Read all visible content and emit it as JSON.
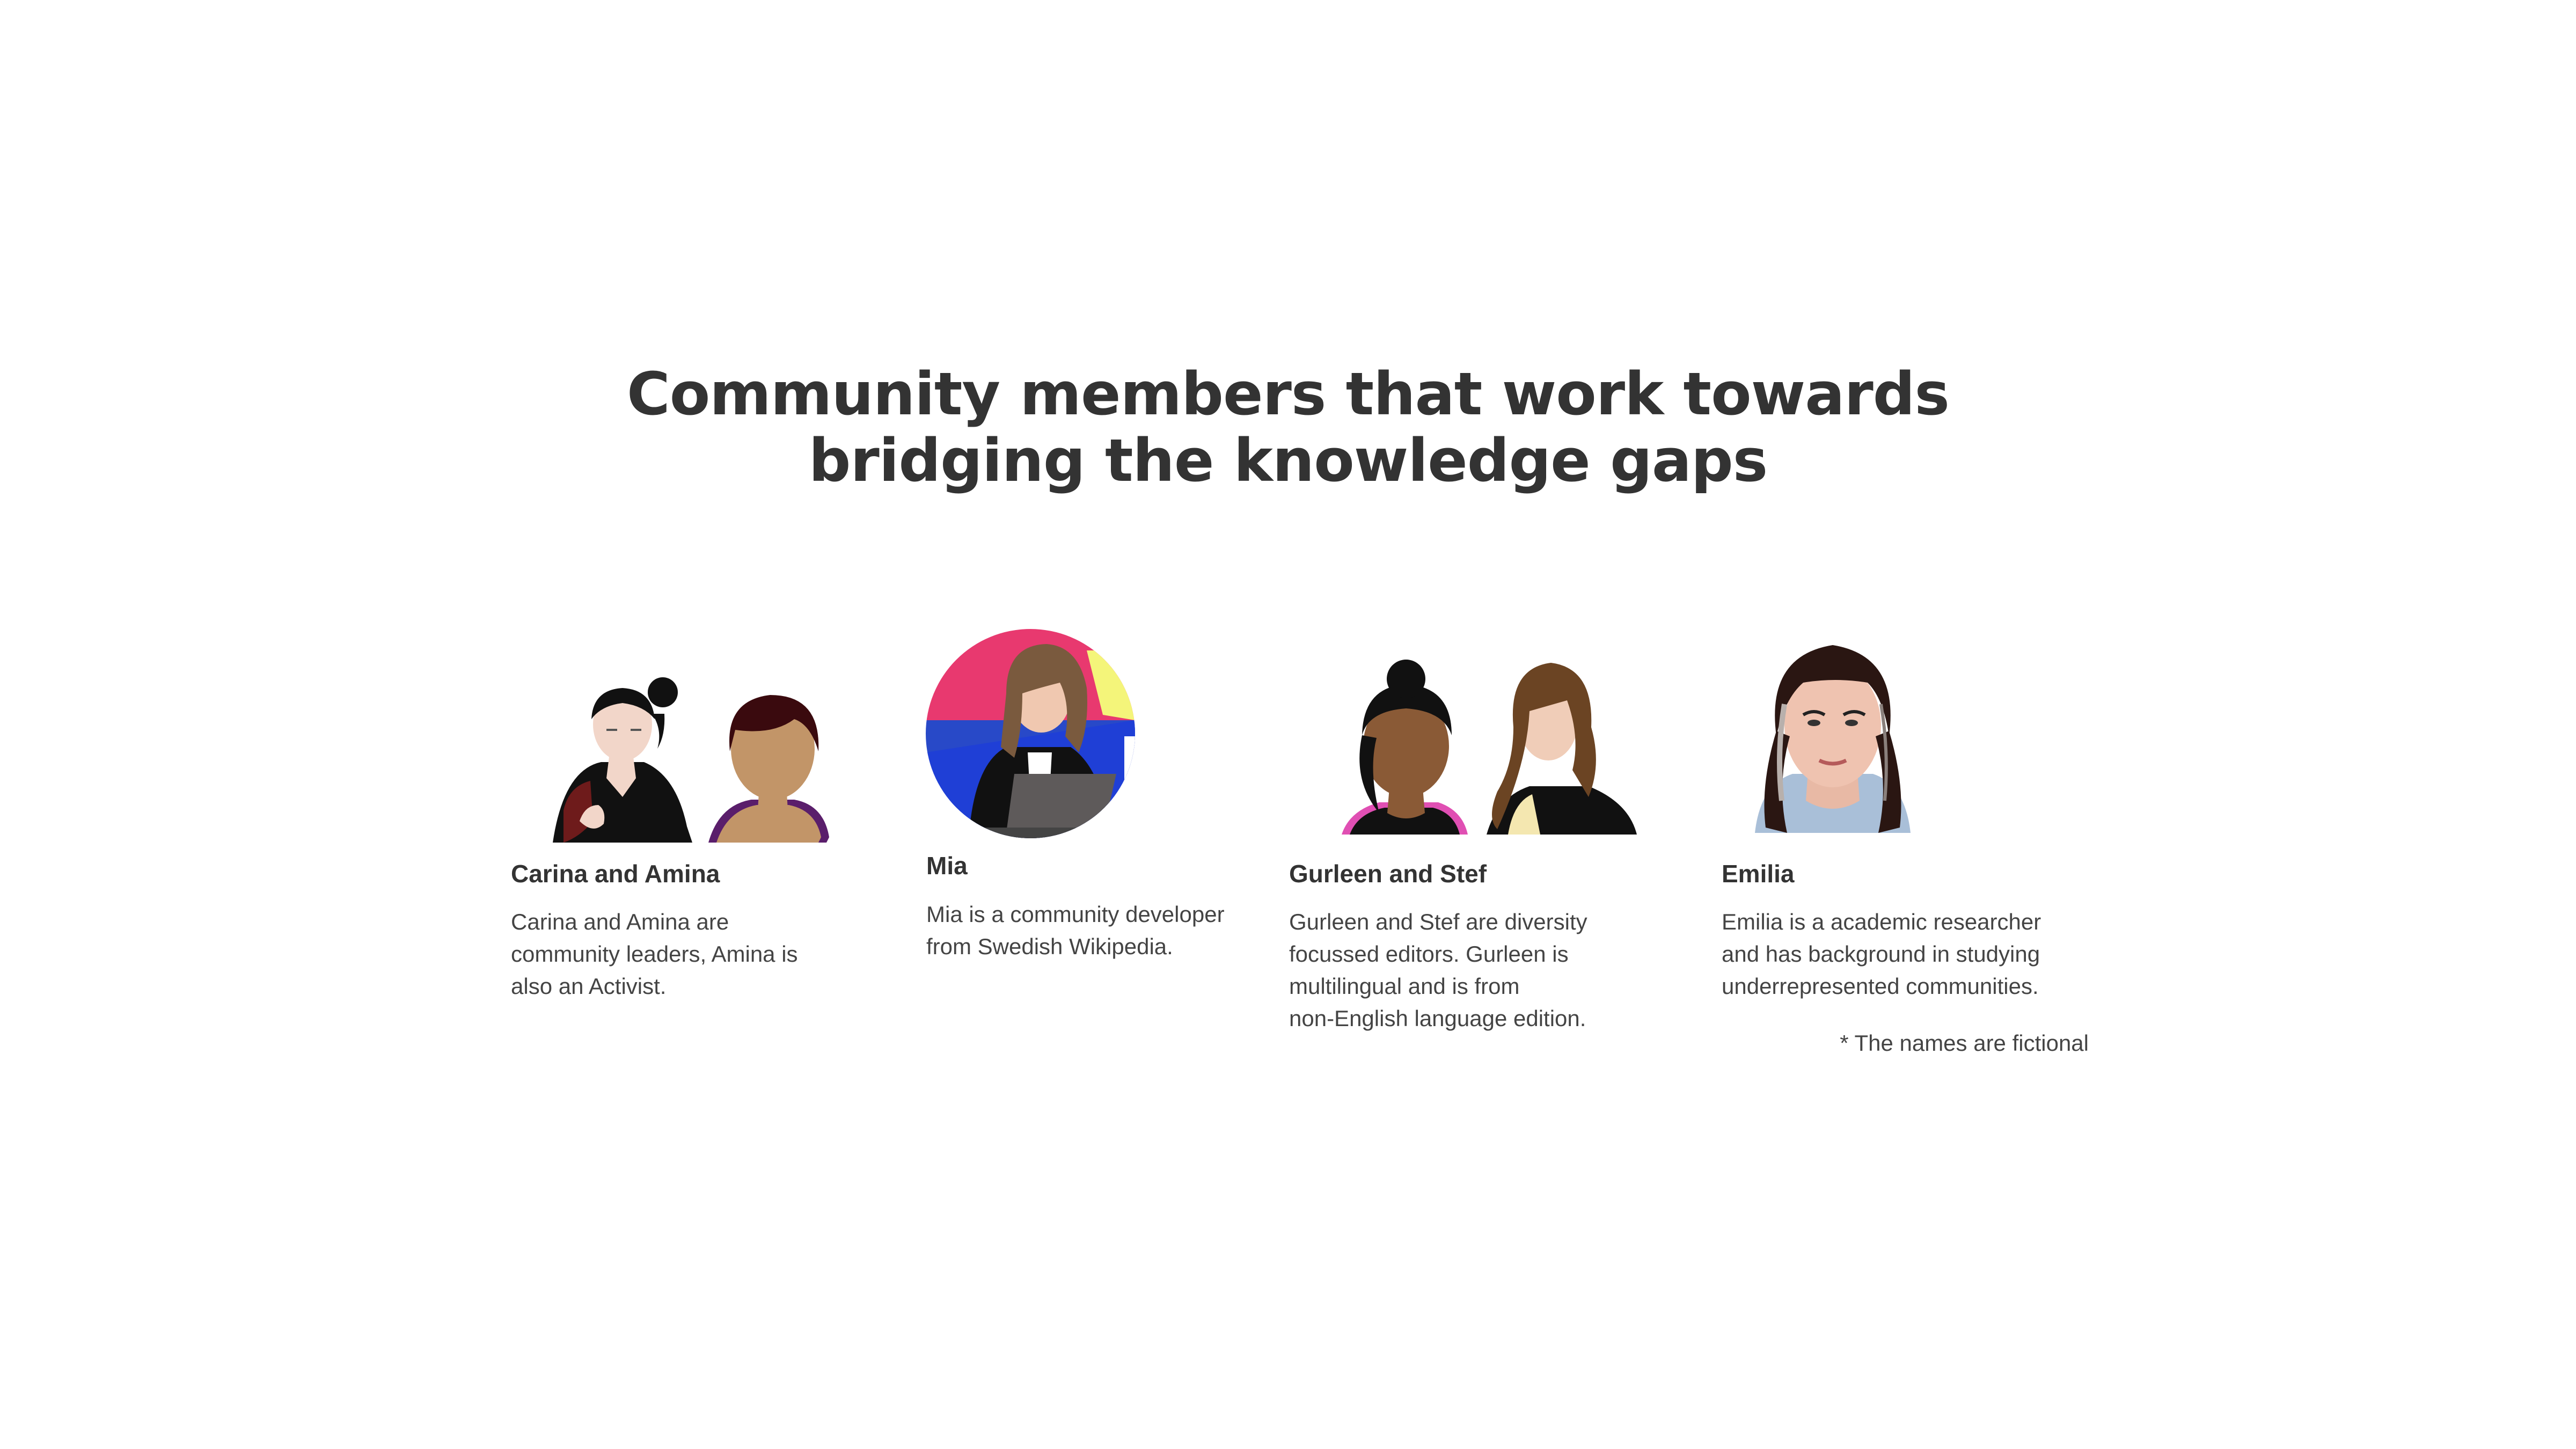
{
  "title": {
    "line1": "Community members that work towards",
    "line2": "bridging the knowledge gaps"
  },
  "members": [
    {
      "name": "Carina and Amina",
      "description_lines": [
        "Carina and Amina are",
        "community leaders, Amina is",
        "also an Activist."
      ],
      "avatar_icon": "carina-and-amina-illustration"
    },
    {
      "name": "Mia",
      "description_lines": [
        "Mia is a community developer",
        "from Swedish Wikipedia."
      ],
      "avatar_icon": "mia-illustration"
    },
    {
      "name": "Gurleen and Stef",
      "description_lines": [
        "Gurleen and Stef are diversity",
        "focussed editors. Gurleen is",
        "multilingual and is from",
        "non-English language edition."
      ],
      "avatar_icon": "gurleen-and-stef-illustration"
    },
    {
      "name": "Emilia",
      "description_lines": [
        "Emilia is a academic researcher",
        "and has background in studying",
        "underrepresented communities."
      ],
      "avatar_icon": "emilia-illustration"
    }
  ],
  "footnote": "* The names are fictional",
  "colors": {
    "text": "#333333",
    "background": "#ffffff",
    "mia_bg_pink": "#e8396f",
    "mia_bg_blue": "#2849c8",
    "mia_bg_yellow": "#f4f57a"
  }
}
